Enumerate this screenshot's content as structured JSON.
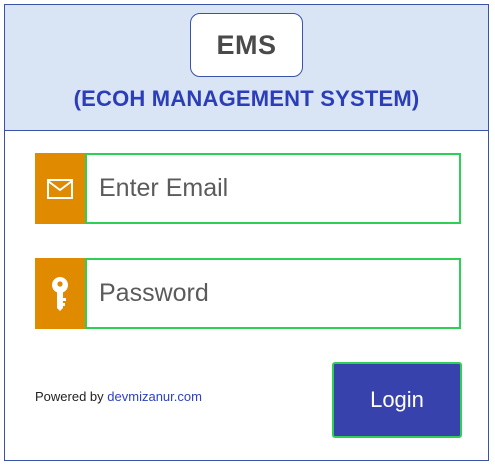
{
  "header": {
    "logo_text": "EMS",
    "subtitle": "(ECOH MANAGEMENT SYSTEM)"
  },
  "form": {
    "email": {
      "icon": "envelope-icon",
      "placeholder": "Enter Email",
      "value": ""
    },
    "password": {
      "icon": "key-icon",
      "placeholder": "Password",
      "value": ""
    },
    "login_label": "Login"
  },
  "footer": {
    "powered_prefix": "Powered by",
    "powered_link": "devmizanur.com"
  },
  "colors": {
    "border": "#3a52a8",
    "header_bg": "#d9e4f5",
    "subtitle": "#2b3db8",
    "icon_bg": "#e08a00",
    "input_border": "#2fcf55",
    "button_bg": "#3742ad",
    "link": "#2d42c0"
  }
}
